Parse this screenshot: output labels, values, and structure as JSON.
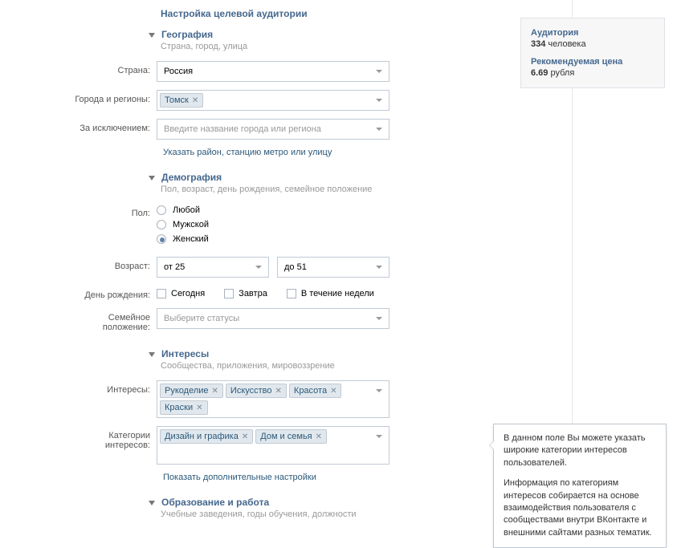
{
  "page_title": "Настройка целевой аудитории",
  "sections": {
    "geo": {
      "title": "География",
      "subtitle": "Страна, город, улица",
      "labels": {
        "country": "Страна:",
        "cities": "Города и регионы:",
        "except": "За исключением:"
      },
      "country_value": "Россия",
      "city_tags": [
        "Томск"
      ],
      "except_placeholder": "Введите название города или региона",
      "link": "Указать район, станцию метро или улицу"
    },
    "demo": {
      "title": "Демография",
      "subtitle": "Пол, возраст, день рождения, семейное положение",
      "labels": {
        "gender": "Пол:",
        "age": "Возраст:",
        "birthday": "День рождения:",
        "status": "Семейное положение:"
      },
      "gender_options": [
        "Любой",
        "Мужской",
        "Женский"
      ],
      "gender_selected": 2,
      "age_from": "от 25",
      "age_to": "до 51",
      "birthday_options": [
        "Сегодня",
        "Завтра",
        "В течение недели"
      ],
      "status_placeholder": "Выберите статусы"
    },
    "interests": {
      "title": "Интересы",
      "subtitle": "Сообщества, приложения, мировоззрение",
      "labels": {
        "interests": "Интересы:",
        "categories": "Категории интересов:"
      },
      "interest_tags": [
        "Рукоделие",
        "Искусство",
        "Красота",
        "Краски"
      ],
      "category_tags": [
        "Дизайн и графика",
        "Дом и семья"
      ],
      "link": "Показать дополнительные настройки"
    },
    "education": {
      "title": "Образование и работа",
      "subtitle": "Учебные заведения, годы обучения, должности"
    }
  },
  "sidebar": {
    "audience_label": "Аудитория",
    "audience_value": "334",
    "audience_unit": "человека",
    "price_label": "Рекомендуемая цена",
    "price_value": "6.69",
    "price_unit": "рубля"
  },
  "tooltip": {
    "p1": "В данном поле Вы можете указать широкие категории интересов пользователей.",
    "p2": "Информация по категориям интересов собирается на основе взаимодействия пользователя с сообществами внутри ВКонтакте и внешними сайтами разных тематик."
  }
}
